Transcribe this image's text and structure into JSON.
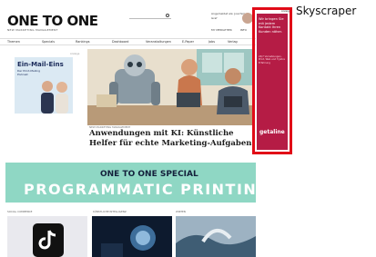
{
  "site": {
    "logo": "ONE TO ONE",
    "tagline": "NEW MARKETING MANAGEMENT",
    "user_text": "Angemeldet als: Joachim Graf",
    "small_links": [
      "MY MEDIATHEK",
      "INFO"
    ]
  },
  "nav": {
    "items": [
      "Themen",
      "Specials",
      "Rankings",
      "Dashboard",
      "Veranstaltungen",
      "E-Paper",
      "Jobs",
      "Verlag"
    ]
  },
  "hero": {
    "ad_title": "Ein-Mail-Eins",
    "ad_subtitle": "Der Print-Mailing Podcast",
    "ad_tag": "Anzeige",
    "kicker": "NEW MARKETING MANAGEMENT",
    "headline": "Anwendungen mit KI: Künstliche Helfer für echte Marketing-Aufgaben"
  },
  "banner": {
    "top": "ONE TO ONE SPECIAL",
    "main": "PROGRAMMATIC PRINTING"
  },
  "cards": [
    "SOCIAL COMMERCE",
    "KÜNSTLICHE INTELLIGENZ",
    "WIRTEN"
  ],
  "skyscraper": {
    "marker": "Anzeige",
    "text": "Wir bringen Sie mit jedem Kontakt Ihren Kunden näher.",
    "note": "24/7 Vernetzungen, Print, Web und 3 Jahre Erfahrung",
    "brand": "getaline",
    "annotation": "Skyscraper",
    "frame_color": "#e10b17",
    "ad_color": "#b51c45"
  },
  "colors": {
    "banner_bg": "#8fd7c4"
  },
  "icons": [
    "search-icon",
    "avatar",
    "robot-illustration",
    "tiktok-icon"
  ]
}
